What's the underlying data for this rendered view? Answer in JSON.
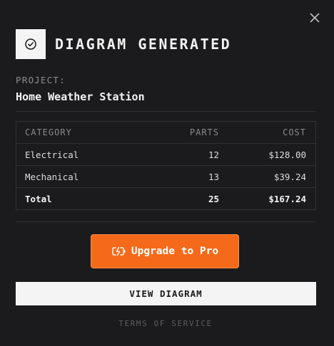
{
  "dialog": {
    "title": "DIAGRAM GENERATED",
    "close_icon": "close-icon",
    "status_icon": "check-circle-icon"
  },
  "project": {
    "label": "PROJECT:",
    "name": "Home Weather Station"
  },
  "table": {
    "headers": [
      "CATEGORY",
      "PARTS",
      "COST"
    ],
    "rows": [
      {
        "category": "Electrical",
        "parts": "12",
        "cost": "$128.00"
      },
      {
        "category": "Mechanical",
        "parts": "13",
        "cost": "$39.24"
      }
    ],
    "total": {
      "category": "Total",
      "parts": "25",
      "cost": "$167.24"
    }
  },
  "actions": {
    "upgrade_label": "Upgrade to Pro",
    "upgrade_icon": "battery-bolt-icon",
    "upgrade_color": "#f56a1a",
    "view_label": "VIEW DIAGRAM",
    "terms_label": "TERMS OF SERVICE"
  }
}
